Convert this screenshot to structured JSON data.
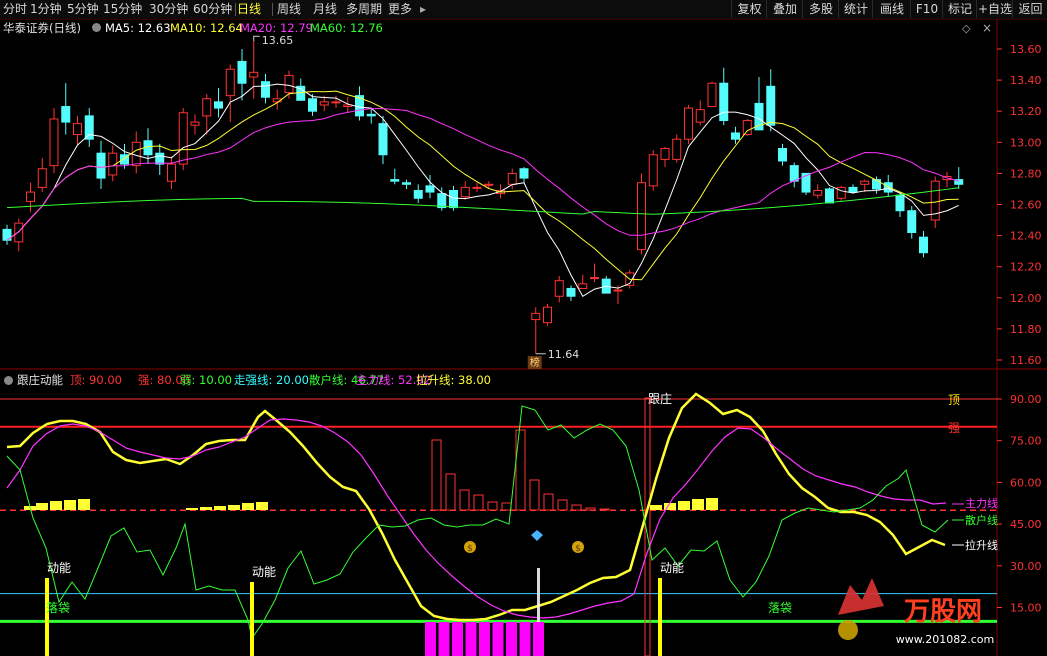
{
  "toolbar": {
    "periods": [
      {
        "label": "分时",
        "active": false
      },
      {
        "label": "1分钟",
        "active": false
      },
      {
        "label": "5分钟",
        "active": false
      },
      {
        "label": "15分钟",
        "active": false
      },
      {
        "label": "30分钟",
        "active": false
      },
      {
        "label": "60分钟",
        "active": false
      },
      {
        "label": "日线",
        "active": true
      },
      {
        "label": "周线",
        "active": false
      },
      {
        "label": "月线",
        "active": false
      },
      {
        "label": "多周期",
        "active": false
      },
      {
        "label": "更多",
        "active": false
      }
    ],
    "buttons": [
      "复权",
      "叠加",
      "多股",
      "统计",
      "画线",
      "F10",
      "标记",
      "+自选",
      "返回"
    ]
  },
  "main_chart": {
    "title": "华泰证券(日线)",
    "ma": [
      {
        "label": "MA5: 12.63",
        "color": "#ffffff"
      },
      {
        "label": "MA10: 12.64",
        "color": "#ffff33"
      },
      {
        "label": "MA20: 12.79",
        "color": "#ff33ff"
      },
      {
        "label": "MA60: 12.76",
        "color": "#33ff33"
      }
    ],
    "high_label": "13.65",
    "low_label": "11.64",
    "low_marker": "榜",
    "y_ticks": [
      "13.60",
      "13.40",
      "13.20",
      "13.00",
      "12.80",
      "12.60",
      "12.40",
      "12.20",
      "12.00",
      "11.80",
      "11.60"
    ]
  },
  "indicator": {
    "title": "跟庄动能",
    "params": [
      {
        "label": "顶: 90.00",
        "color": "#ff3333"
      },
      {
        "label": "强: 80.00",
        "color": "#ff3333"
      },
      {
        "label": "弱: 10.00",
        "color": "#33ff33"
      },
      {
        "label": "走强线: 20.00",
        "color": "#33ffff"
      },
      {
        "label": "散户线: 46.77",
        "color": "#33ff33"
      },
      {
        "label": "主力线: 52.92",
        "color": "#ff33ff"
      },
      {
        "label": "拉升线: 38.00",
        "color": "#ffff33"
      }
    ],
    "y_ticks": [
      "90.00",
      "75.00",
      "60.00",
      "45.00",
      "30.00",
      "15.00"
    ],
    "labels": {
      "top": "顶",
      "strong": "强",
      "follow": "跟庄",
      "main_line": "主力线",
      "retail_line": "散户线",
      "pull_line": "拉升线",
      "kinetic": "动能",
      "pocket": "落袋"
    }
  },
  "watermark": {
    "brand": "万股网",
    "url": "www.201082.com"
  },
  "colors": {
    "up": "#ff3232",
    "down": "#54fcfc",
    "ma5": "#ffffff",
    "ma10": "#ffff33",
    "ma20": "#ff33ff",
    "ma60": "#33ff33"
  }
}
